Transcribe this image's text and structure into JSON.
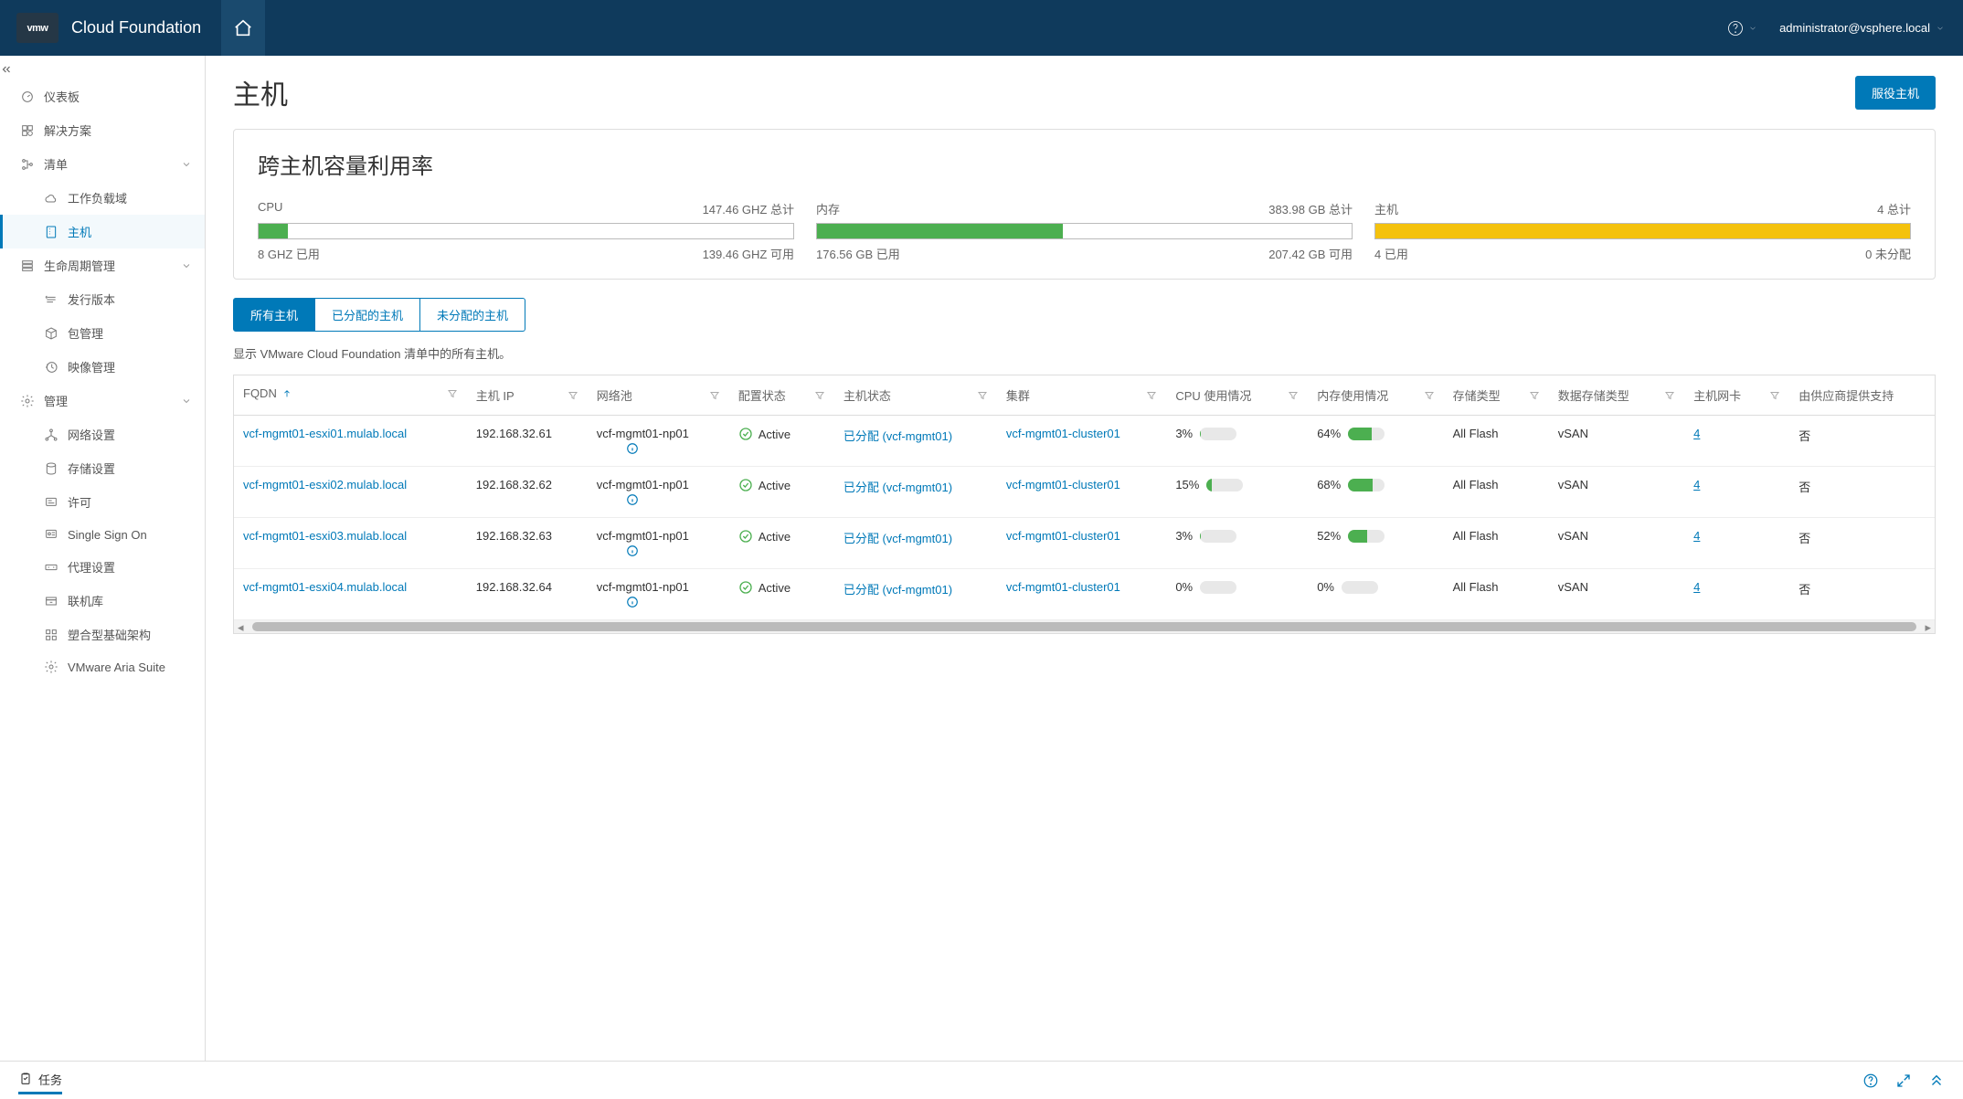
{
  "topbar": {
    "logo_text": "vmw",
    "brand": "Cloud Foundation",
    "user": "administrator@vsphere.local"
  },
  "sidebar": {
    "items": [
      {
        "id": "dashboard",
        "label": "仪表板",
        "icon": "gauge"
      },
      {
        "id": "solutions",
        "label": "解决方案",
        "icon": "solutions"
      },
      {
        "id": "inventory",
        "label": "清单",
        "icon": "tree",
        "expandable": true,
        "expanded": true,
        "children": [
          {
            "id": "workloaddomain",
            "label": "工作负载域",
            "icon": "cloud"
          },
          {
            "id": "hosts",
            "label": "主机",
            "icon": "server",
            "active": true
          }
        ]
      },
      {
        "id": "lifecycle",
        "label": "生命周期管理",
        "icon": "stack",
        "expandable": true,
        "expanded": true,
        "children": [
          {
            "id": "releases",
            "label": "发行版本",
            "icon": "release"
          },
          {
            "id": "bundles",
            "label": "包管理",
            "icon": "package"
          },
          {
            "id": "images",
            "label": "映像管理",
            "icon": "history"
          }
        ]
      },
      {
        "id": "admin",
        "label": "管理",
        "icon": "gear",
        "expandable": true,
        "expanded": true,
        "children": [
          {
            "id": "network",
            "label": "网络设置",
            "icon": "network"
          },
          {
            "id": "storage",
            "label": "存储设置",
            "icon": "storage"
          },
          {
            "id": "license",
            "label": "许可",
            "icon": "license"
          },
          {
            "id": "sso",
            "label": "Single Sign On",
            "icon": "sso"
          },
          {
            "id": "proxy",
            "label": "代理设置",
            "icon": "proxy"
          },
          {
            "id": "depot",
            "label": "联机库",
            "icon": "depot"
          },
          {
            "id": "composable",
            "label": "塑合型基础架构",
            "icon": "composable"
          },
          {
            "id": "aria",
            "label": "VMware Aria Suite",
            "icon": "gear2"
          }
        ]
      }
    ]
  },
  "page": {
    "title": "主机",
    "action_button": "服役主机"
  },
  "capacity": {
    "title": "跨主机容量利用率",
    "boxes": [
      {
        "label": "CPU",
        "total": "147.46 GHZ 总计",
        "used": "8 GHZ 已用",
        "free": "139.46 GHZ 可用",
        "pct": 5.4,
        "color": "#4caf50"
      },
      {
        "label": "内存",
        "total": "383.98 GB 总计",
        "used": "176.56 GB 已用",
        "free": "207.42 GB 可用",
        "pct": 46,
        "color": "#4caf50"
      },
      {
        "label": "主机",
        "total": "4 总计",
        "used": "4 已用",
        "free": "0 未分配",
        "pct": 100,
        "color": "#f4c20d"
      }
    ]
  },
  "tabs": [
    {
      "id": "all",
      "label": "所有主机",
      "active": true
    },
    {
      "id": "assigned",
      "label": "已分配的主机"
    },
    {
      "id": "unassigned",
      "label": "未分配的主机"
    }
  ],
  "description": "显示 VMware Cloud Foundation 清单中的所有主机。",
  "table": {
    "columns": [
      "FQDN",
      "主机 IP",
      "网络池",
      "配置状态",
      "主机状态",
      "集群",
      "CPU 使用情况",
      "内存使用情况",
      "存储类型",
      "数据存储类型",
      "主机网卡",
      "由供应商提供支持"
    ],
    "rows": [
      {
        "fqdn": "vcf-mgmt01-esxi01.mulab.local",
        "ip": "192.168.32.61",
        "pool": "vcf-mgmt01-np01",
        "config": "Active",
        "hoststate": "已分配 (vcf-mgmt01)",
        "cluster": "vcf-mgmt01-cluster01",
        "cpu": "3%",
        "cpupct": 3,
        "mem": "64%",
        "mempct": 64,
        "stype": "All Flash",
        "dstype": "vSAN",
        "nics": "4",
        "vendor": "否"
      },
      {
        "fqdn": "vcf-mgmt01-esxi02.mulab.local",
        "ip": "192.168.32.62",
        "pool": "vcf-mgmt01-np01",
        "config": "Active",
        "hoststate": "已分配 (vcf-mgmt01)",
        "cluster": "vcf-mgmt01-cluster01",
        "cpu": "15%",
        "cpupct": 15,
        "mem": "68%",
        "mempct": 68,
        "stype": "All Flash",
        "dstype": "vSAN",
        "nics": "4",
        "vendor": "否"
      },
      {
        "fqdn": "vcf-mgmt01-esxi03.mulab.local",
        "ip": "192.168.32.63",
        "pool": "vcf-mgmt01-np01",
        "config": "Active",
        "hoststate": "已分配 (vcf-mgmt01)",
        "cluster": "vcf-mgmt01-cluster01",
        "cpu": "3%",
        "cpupct": 3,
        "mem": "52%",
        "mempct": 52,
        "stype": "All Flash",
        "dstype": "vSAN",
        "nics": "4",
        "vendor": "否"
      },
      {
        "fqdn": "vcf-mgmt01-esxi04.mulab.local",
        "ip": "192.168.32.64",
        "pool": "vcf-mgmt01-np01",
        "config": "Active",
        "hoststate": "已分配 (vcf-mgmt01)",
        "cluster": "vcf-mgmt01-cluster01",
        "cpu": "0%",
        "cpupct": 0,
        "mem": "0%",
        "mempct": 0,
        "stype": "All Flash",
        "dstype": "vSAN",
        "nics": "4",
        "vendor": "否"
      }
    ]
  },
  "footer": {
    "tasks_label": "任务"
  }
}
